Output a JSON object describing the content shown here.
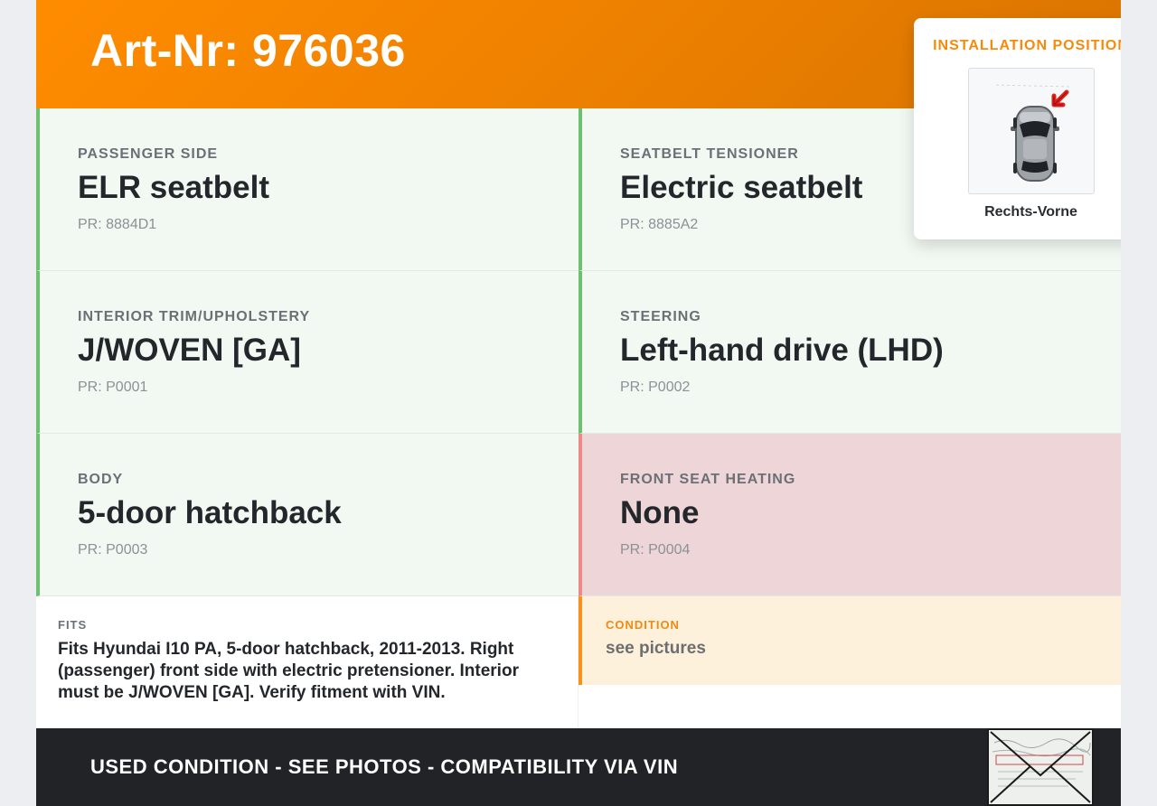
{
  "header": {
    "title": "Art-Nr: 976036",
    "accent_color": "#f08200"
  },
  "specs": [
    {
      "label": "PASSENGER SIDE",
      "value": "ELR seatbelt",
      "pr": "PR: 8884D1",
      "status": "ok"
    },
    {
      "label": "SEATBELT TENSIONER",
      "value": "Electric seatbelt",
      "pr": "PR: 8885A2",
      "status": "ok"
    },
    {
      "label": "INTERIOR TRIM/UPHOLSTERY",
      "value": "J/WOVEN [GA]",
      "pr": "PR: P0001",
      "status": "ok"
    },
    {
      "label": "STEERING",
      "value": "Left-hand drive (LHD)",
      "pr": "PR: P0002",
      "status": "ok"
    },
    {
      "label": "BODY",
      "value": "5-door hatchback",
      "pr": "PR: P0003",
      "status": "ok"
    },
    {
      "label": "FRONT SEAT HEATING",
      "value": "None",
      "pr": "PR: P0004",
      "status": "bad"
    }
  ],
  "fits": {
    "label": "FITS",
    "text": "Fits Hyundai I10 PA, 5-door hatchback, 2011-2013. Right (passenger) front side with electric pretensioner. Interior must be J/WOVEN [GA]. Verify fitment with VIN."
  },
  "condition": {
    "label": "CONDITION",
    "text": "see pictures"
  },
  "footer": {
    "text": "USED CONDITION - SEE PHOTOS - COMPATIBILITY VIA VIN"
  },
  "installation": {
    "title": "INSTALLATION POSITION",
    "caption": "Rechts-Vorne",
    "arrow_color": "#e0201c"
  },
  "colors": {
    "ok_bg": "#f2f8f2",
    "ok_border": "#6cc070",
    "bad_bg": "#eed5d7",
    "bad_border": "#ec8a8a",
    "condition_bg": "#fef1dc",
    "footer_bg": "#212327"
  }
}
